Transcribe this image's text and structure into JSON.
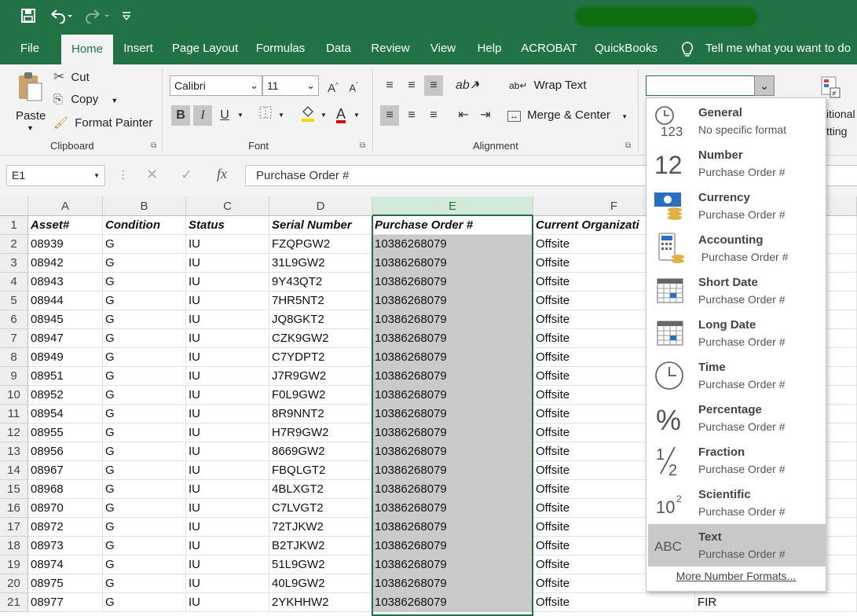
{
  "tabs": [
    "File",
    "Home",
    "Insert",
    "Page Layout",
    "Formulas",
    "Data",
    "Review",
    "View",
    "Help",
    "ACROBAT",
    "QuickBooks"
  ],
  "tell_me": "Tell me what you want to do",
  "clipboard": {
    "paste": "Paste",
    "cut": "Cut",
    "copy": "Copy",
    "format_painter": "Format Painter",
    "label": "Clipboard"
  },
  "font": {
    "name": "Calibri",
    "size": "11",
    "label": "Font",
    "bold": "B",
    "italic": "I",
    "underline": "U"
  },
  "alignment": {
    "wrap_text": "Wrap Text",
    "merge_center": "Merge & Center",
    "label": "Alignment"
  },
  "number_format_value": "",
  "cond_format_partial": {
    "line1": "itional",
    "line2": "tting"
  },
  "name_box": "E1",
  "formula_value": "Purchase Order #",
  "columns": [
    "A",
    "B",
    "C",
    "D",
    "E",
    "F"
  ],
  "headers": [
    "Asset#",
    "Condition",
    "Status",
    "Serial Number",
    "Purchase Order #",
    "Current Organizati"
  ],
  "rows": [
    [
      "1",
      "08939",
      "G",
      "IU",
      "FZQPGW2",
      "10386268079",
      "Offsite"
    ],
    [
      "2",
      "08942",
      "G",
      "IU",
      "31L9GW2",
      "10386268079",
      "Offsite"
    ],
    [
      "3",
      "08943",
      "G",
      "IU",
      "9Y43QT2",
      "10386268079",
      "Offsite"
    ],
    [
      "4",
      "08944",
      "G",
      "IU",
      "7HR5NT2",
      "10386268079",
      "Offsite"
    ],
    [
      "5",
      "08945",
      "G",
      "IU",
      "JQ8GKT2",
      "10386268079",
      "Offsite"
    ],
    [
      "6",
      "08947",
      "G",
      "IU",
      "CZK9GW2",
      "10386268079",
      "Offsite"
    ],
    [
      "7",
      "08949",
      "G",
      "IU",
      "C7YDPT2",
      "10386268079",
      "Offsite"
    ],
    [
      "8",
      "08951",
      "G",
      "IU",
      "J7R9GW2",
      "10386268079",
      "Offsite"
    ],
    [
      "9",
      "08952",
      "G",
      "IU",
      "F0L9GW2",
      "10386268079",
      "Offsite"
    ],
    [
      "10",
      "08954",
      "G",
      "IU",
      "8R9NNT2",
      "10386268079",
      "Offsite"
    ],
    [
      "11",
      "08955",
      "G",
      "IU",
      "H7R9GW2",
      "10386268079",
      "Offsite"
    ],
    [
      "12",
      "08956",
      "G",
      "IU",
      "8669GW2",
      "10386268079",
      "Offsite"
    ],
    [
      "13",
      "08967",
      "G",
      "IU",
      "FBQLGT2",
      "10386268079",
      "Offsite"
    ],
    [
      "14",
      "08968",
      "G",
      "IU",
      "4BLXGT2",
      "10386268079",
      "Offsite"
    ],
    [
      "15",
      "08970",
      "G",
      "IU",
      "C7LVGT2",
      "10386268079",
      "Offsite"
    ],
    [
      "16",
      "08972",
      "G",
      "IU",
      "72TJKW2",
      "10386268079",
      "Offsite"
    ],
    [
      "17",
      "08973",
      "G",
      "IU",
      "B2TJKW2",
      "10386268079",
      "Offsite"
    ],
    [
      "18",
      "08974",
      "G",
      "IU",
      "51L9GW2",
      "10386268079",
      "Offsite"
    ],
    [
      "19",
      "08975",
      "G",
      "IU",
      "40L9GW2",
      "10386268079",
      "Offsite"
    ],
    [
      "20",
      "08977",
      "G",
      "IU",
      "2YKHHW2",
      "10386268079",
      "Offsite"
    ]
  ],
  "g_column_last": "FIR",
  "row_numbers": [
    "1",
    "2",
    "3",
    "4",
    "5",
    "6",
    "7",
    "8",
    "9",
    "10",
    "11",
    "12",
    "13",
    "14",
    "15",
    "16",
    "17",
    "18",
    "19",
    "20",
    "21"
  ],
  "formats": [
    {
      "name": "General",
      "sample": "No specific format",
      "icon": "clock-123-icon"
    },
    {
      "name": "Number",
      "sample": "Purchase Order #",
      "icon": "number-12-icon"
    },
    {
      "name": "Currency",
      "sample": "Purchase Order #",
      "icon": "currency-icon"
    },
    {
      "name": "Accounting",
      "sample": " Purchase Order #",
      "icon": "accounting-icon"
    },
    {
      "name": "Short Date",
      "sample": "Purchase Order #",
      "icon": "calendar-icon"
    },
    {
      "name": "Long Date",
      "sample": "Purchase Order #",
      "icon": "calendar-icon"
    },
    {
      "name": "Time",
      "sample": "Purchase Order #",
      "icon": "clock-icon"
    },
    {
      "name": "Percentage",
      "sample": "Purchase Order #",
      "icon": "percent-icon"
    },
    {
      "name": "Fraction",
      "sample": "Purchase Order #",
      "icon": "fraction-icon"
    },
    {
      "name": "Scientific",
      "sample": "Purchase Order #",
      "icon": "scientific-icon"
    },
    {
      "name": "Text",
      "sample": "Purchase Order #",
      "icon": "abc-icon"
    }
  ],
  "more_formats": "More Number Formats...",
  "accent": "#217346"
}
